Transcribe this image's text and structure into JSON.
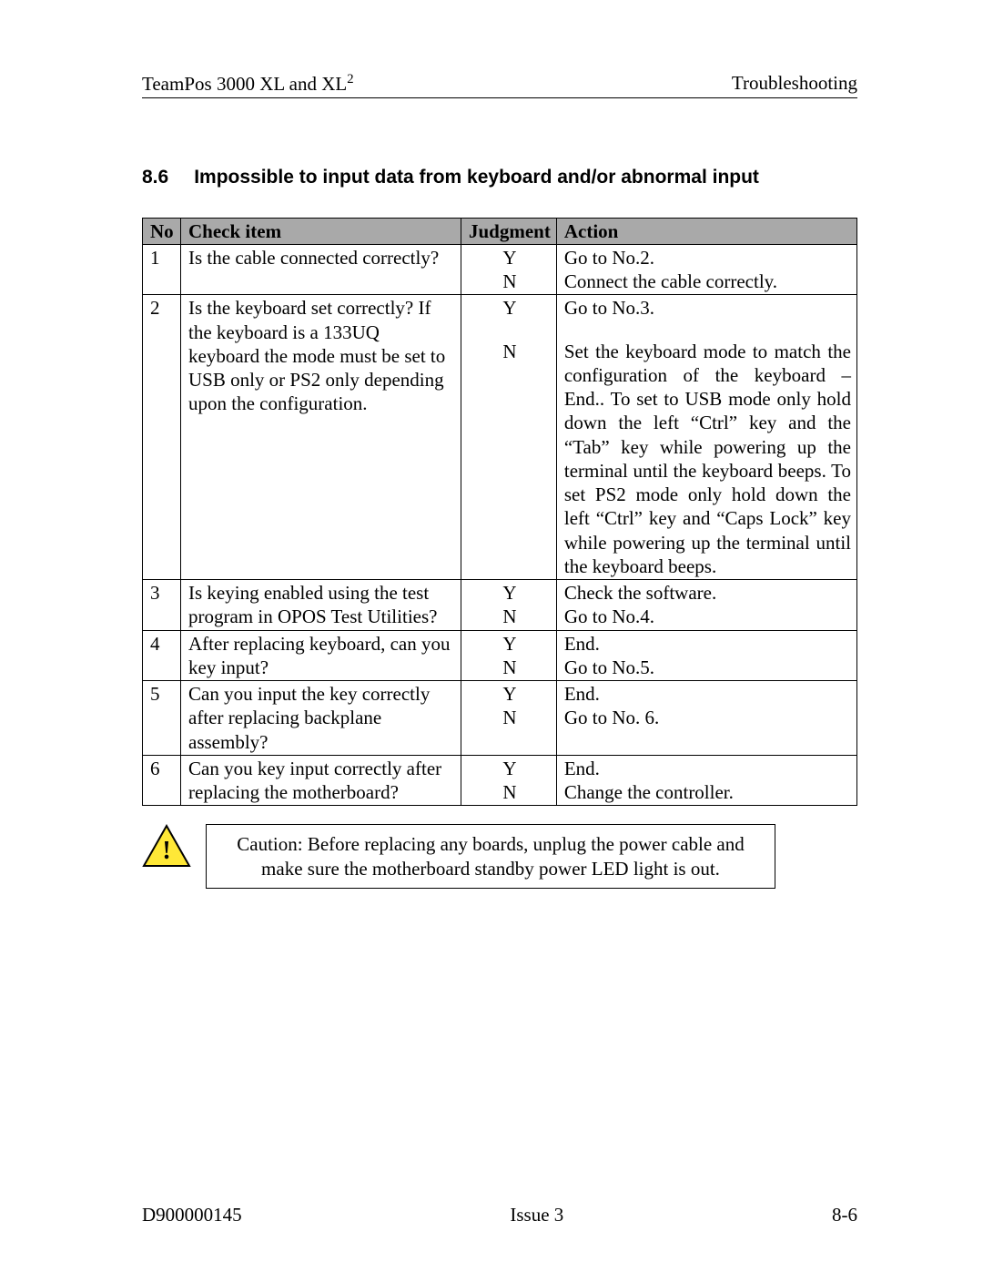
{
  "header": {
    "left_prefix": "TeamPos 3000 XL and XL",
    "left_sup": "2",
    "right": "Troubleshooting"
  },
  "section": {
    "number": "8.6",
    "title": "Impossible to input data from keyboard and/or abnormal input"
  },
  "table": {
    "headers": {
      "no": "No",
      "item": "Check item",
      "judgment": "Judgment",
      "action": "Action"
    },
    "rows": [
      {
        "no": "1",
        "item": "Is the cable connected correctly?",
        "y": "Y",
        "n": "N",
        "act_y": "Go to No.2.",
        "act_n": "Connect the cable correctly."
      },
      {
        "no": "2",
        "item": "Is the keyboard set correctly?  If the keyboard is a 133UQ keyboard the mode must be set to USB only or PS2 only depending upon the configuration.",
        "y": "Y",
        "n": "N",
        "act_y": "Go to No.3.",
        "act_n": "Set the keyboard mode to match the configuration of the keyboard – End.. \nTo set to USB mode only hold down the left “Ctrl” key and the “Tab” key while powering up the terminal until the keyboard beeps. To set PS2 mode only hold down the left “Ctrl” key and “Caps Lock” key while powering up the terminal until the keyboard beeps."
      },
      {
        "no": "3",
        "item": "Is keying enabled using the test program in OPOS Test Utilities?",
        "y": "Y",
        "n": "N",
        "act_y": "Check the software.",
        "act_n": "Go to No.4."
      },
      {
        "no": "4",
        "item": "After replacing keyboard, can you key input?",
        "y": "Y",
        "n": "N",
        "act_y": "End.",
        "act_n": "Go to No.5."
      },
      {
        "no": "5",
        "item": "Can you input the key correctly after replacing backplane assembly?",
        "y": "Y",
        "n": "N",
        "act_y": "End.",
        "act_n": "Go to No. 6."
      },
      {
        "no": "6",
        "item": "Can you key input correctly after replacing the motherboard?",
        "y": "Y",
        "n": "N",
        "act_y": "End.",
        "act_n": "Change the controller."
      }
    ]
  },
  "caution": {
    "text": "Caution: Before replacing any boards, unplug the power cable and make sure the motherboard standby power LED light is out."
  },
  "footer": {
    "left": "D900000145",
    "center": "Issue 3",
    "right": "8-6"
  }
}
